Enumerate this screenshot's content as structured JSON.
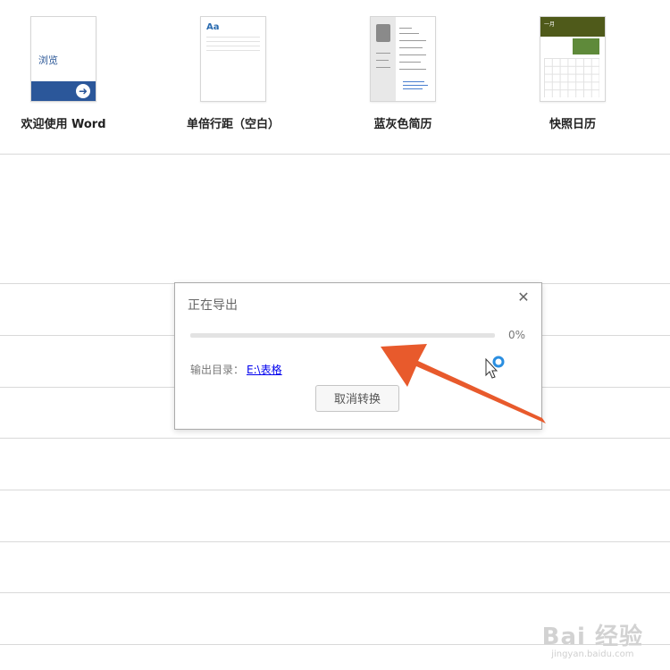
{
  "templates": [
    {
      "thumb_text": "浏览",
      "label": "欢迎使用 Word"
    },
    {
      "thumb_text": "Aa",
      "label": "单倍行距（空白）"
    },
    {
      "thumb_text": "",
      "label": "蓝灰色简历"
    },
    {
      "thumb_text": "一月",
      "label": "快照日历"
    }
  ],
  "dialog": {
    "title": "正在导出",
    "close_icon": "close-icon",
    "progress_text": "0%",
    "progress_value": 0,
    "output_label": "输出目录：",
    "output_path": "E:\\表格",
    "cancel_label": "取消转换"
  },
  "colors": {
    "word_blue": "#2b579a",
    "annotation_arrow": "#e85a2c",
    "link": "#0000ee"
  },
  "watermark": {
    "main": "Bai 经验",
    "sub": "jingyan.baidu.com"
  }
}
